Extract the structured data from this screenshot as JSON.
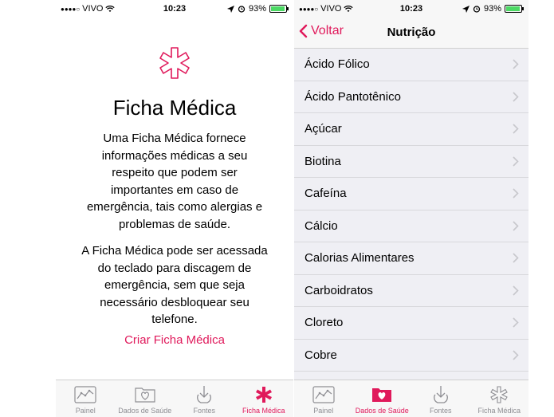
{
  "left": {
    "status": {
      "carrier": "VIVO",
      "time": "10:23",
      "battery": "93%"
    },
    "title": "Ficha Médica",
    "description_1": [
      "Uma Ficha Médica fornece",
      "informações médicas a seu",
      "respeito que podem ser",
      "importantes em caso de",
      "emergência, tais como alergias e",
      "problemas de saúde."
    ],
    "description_2": [
      "A Ficha Médica pode ser acessada",
      "do teclado para discagem de",
      "emergência, sem que seja",
      "necessário desbloquear seu",
      "telefone."
    ],
    "create_link": "Criar Ficha Médica",
    "tabs": [
      {
        "label": "Painel",
        "icon": "dashboard-icon",
        "active": false
      },
      {
        "label": "Dados de Saúde",
        "icon": "health-data-icon",
        "active": false
      },
      {
        "label": "Fontes",
        "icon": "sources-icon",
        "active": false
      },
      {
        "label": "Ficha Médica",
        "icon": "medical-id-icon",
        "active": true
      }
    ]
  },
  "right": {
    "status": {
      "carrier": "VIVO",
      "time": "10:23",
      "battery": "93%"
    },
    "back_label": "Voltar",
    "nav_title": "Nutrição",
    "items": [
      "Ácido Fólico",
      "Ácido Pantotênico",
      "Açúcar",
      "Biotina",
      "Cafeína",
      "Cálcio",
      "Calorias Alimentares",
      "Carboidratos",
      "Cloreto",
      "Cobre"
    ],
    "tabs": [
      {
        "label": "Painel",
        "icon": "dashboard-icon",
        "active": false
      },
      {
        "label": "Dados de Saúde",
        "icon": "health-data-icon",
        "active": true
      },
      {
        "label": "Fontes",
        "icon": "sources-icon",
        "active": false
      },
      {
        "label": "Ficha Médica",
        "icon": "medical-id-icon",
        "active": false
      }
    ]
  },
  "colors": {
    "accent": "#e0195b",
    "inactive": "#8e8e93",
    "battery": "#4cd964"
  }
}
